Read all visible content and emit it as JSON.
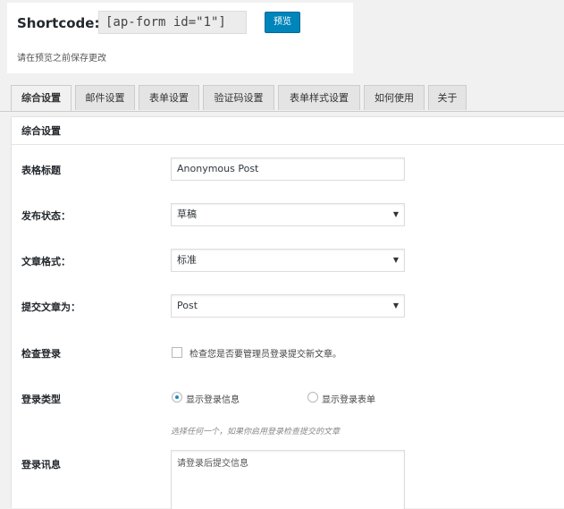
{
  "shortcode": {
    "label": "Shortcode:",
    "value": "[ap-form id=\"1\"]",
    "preview_label": "预览",
    "note": "请在预览之前保存更改"
  },
  "tabs": [
    {
      "label": "综合设置",
      "active": true
    },
    {
      "label": "邮件设置",
      "active": false
    },
    {
      "label": "表单设置",
      "active": false
    },
    {
      "label": "验证码设置",
      "active": false
    },
    {
      "label": "表单样式设置",
      "active": false
    },
    {
      "label": "如何使用",
      "active": false
    },
    {
      "label": "关于",
      "active": false
    }
  ],
  "panel": {
    "title": "综合设置",
    "form_title": {
      "label": "表格标题",
      "value": "Anonymous Post"
    },
    "post_status": {
      "label": "发布状态：",
      "selected": "草稿"
    },
    "post_format": {
      "label": "文章格式：",
      "selected": "标准"
    },
    "submit_as": {
      "label": "提交文章为：",
      "selected": "Post"
    },
    "login_check": {
      "label": "检查登录",
      "checked": false,
      "text": "检查您是否要管理员登录提交新文章。"
    },
    "login_type": {
      "label": "登录类型",
      "options": [
        {
          "label": "显示登录信息",
          "checked": true
        },
        {
          "label": "显示登录表单",
          "checked": false
        }
      ],
      "hint": "选择任何一个，如果你启用登录检查提交的文章"
    },
    "login_message": {
      "label": "登录讯息",
      "value": "请登录后提交信息"
    }
  },
  "colors": {
    "primary_button": "#0085ba",
    "radio_dot": "#1e8cbe"
  },
  "icons": {
    "select_arrow": "▼"
  }
}
